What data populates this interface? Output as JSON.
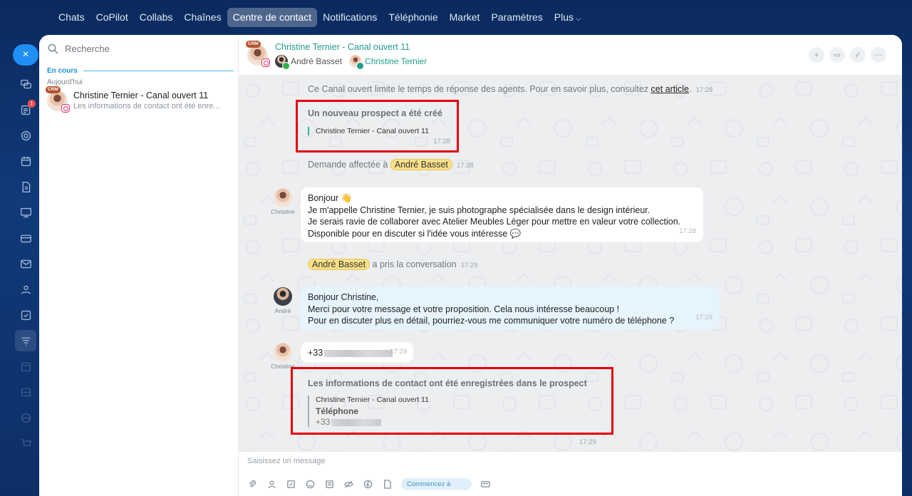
{
  "nav": {
    "items": [
      "Chats",
      "CoPilot",
      "Collabs",
      "Chaînes",
      "Centre de contact",
      "Notifications",
      "Téléphonie",
      "Market",
      "Paramètres",
      "Plus"
    ],
    "active_index": 4
  },
  "rail": {
    "close_label": "×",
    "badge": "1"
  },
  "sidebar": {
    "search_placeholder": "Recherche",
    "section": "En cours",
    "day": "Aujourd'hui",
    "conversation": {
      "crm": "CRM",
      "name": "Christine Ternier - Canal ouvert 11",
      "preview": "Les informations de contact ont été enre..."
    }
  },
  "header": {
    "crm": "CRM",
    "title": "Christine Ternier - Canal ouvert 11",
    "participant1": "André Basset",
    "participant2": "Christine Ternier",
    "actions": [
      "+",
      "⇨",
      "✓",
      "⋯"
    ]
  },
  "messages": {
    "notice": {
      "text": "Ce Canal ouvert limite le temps de réponse des agents. Pour en savoir plus, consultez ",
      "link": "cet article",
      "tail": ".",
      "time": "17:28"
    },
    "lead_created": {
      "title": "Un nouveau prospect a été créé",
      "entry": "Christine Ternier - Canal ouvert 11",
      "time": "17:28"
    },
    "assigned": {
      "text": "Demande affectée à ",
      "name": "André Basset",
      "time": "17:28"
    },
    "client_msg": {
      "author": "Christine",
      "lines": [
        "Bonjour 👋",
        "Je m'appelle Christine Ternier, je suis photographe spécialisée dans le design intérieur.",
        "Je serais ravie de collaborer avec Atelier Meubles Léger pour mettre en valeur votre collection.",
        "Disponible pour en discuter si l'idée vous intéresse 💬"
      ],
      "time": "17:28"
    },
    "took_over": {
      "name": "André Basset",
      "text": " a pris la conversation",
      "time": "17:29"
    },
    "agent_msg": {
      "author": "André",
      "lines": [
        "Bonjour Christine,",
        "Merci pour votre message et votre proposition. Cela nous intéresse beaucoup !",
        "Pour en discuter plus en détail, pourriez-vous me communiquer votre numéro de téléphone ?"
      ],
      "time": "17:29"
    },
    "phone_msg": {
      "author": "Christine",
      "text": "+33",
      "time": "17:29"
    },
    "contact_saved": {
      "title": "Les informations de contact ont été enregistrées dans le prospect",
      "entry": "Christine Ternier - Canal ouvert 11",
      "label": "Téléphone",
      "value": "+33",
      "time": "17:29"
    }
  },
  "composer": {
    "placeholder": "Saisissez un message",
    "start_button": "Commencez à"
  },
  "colors": {
    "accent": "#1f8ef5",
    "teal": "#1f9d8a",
    "highlight_box": "#e3000f",
    "name_pill": "#fbe089"
  }
}
